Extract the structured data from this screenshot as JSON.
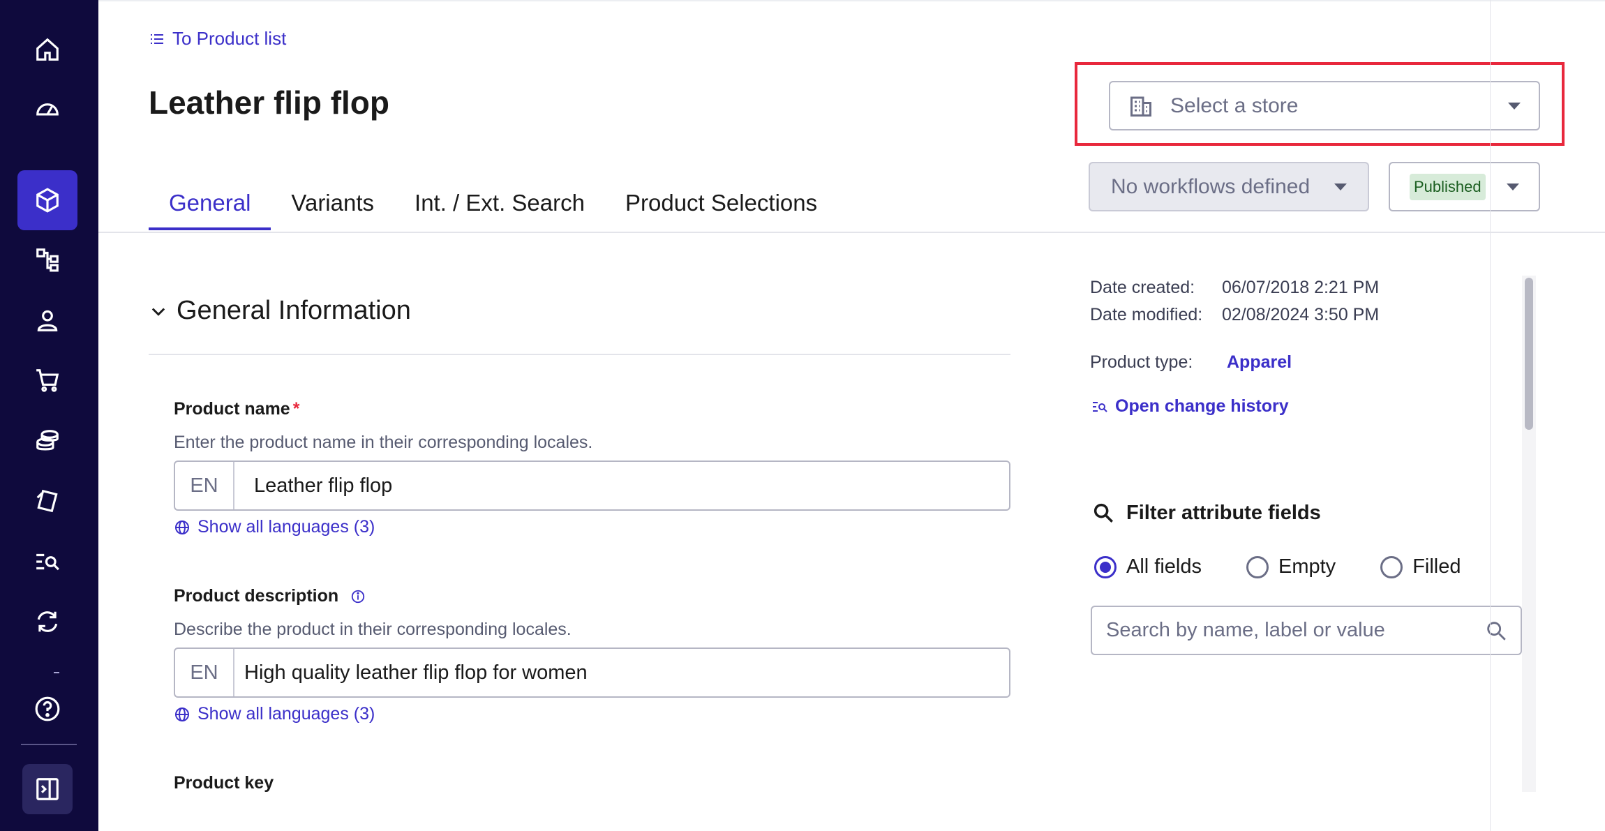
{
  "nav": {
    "items": [
      {
        "name": "home-icon"
      },
      {
        "name": "dashboard-icon"
      },
      {
        "name": "products-icon",
        "active": true
      },
      {
        "name": "categories-icon"
      },
      {
        "name": "customers-icon"
      },
      {
        "name": "orders-icon"
      },
      {
        "name": "prices-icon"
      },
      {
        "name": "discounts-icon"
      },
      {
        "name": "search-index-icon"
      },
      {
        "name": "operations-icon"
      },
      {
        "name": "help-icon"
      },
      {
        "name": "collapse-sidebar-icon"
      }
    ]
  },
  "header": {
    "back_link": "To Product list",
    "title": "Leather flip flop",
    "store_select_placeholder": "Select a store",
    "workflow_label": "No workflows defined",
    "status_label": "Published"
  },
  "tabs": [
    {
      "label": "General",
      "active": true
    },
    {
      "label": "Variants"
    },
    {
      "label": "Int. / Ext. Search"
    },
    {
      "label": "Product Selections"
    }
  ],
  "general": {
    "section_title": "General Information",
    "product_name": {
      "label": "Product name",
      "required_mark": "*",
      "hint": "Enter the product name in their corresponding locales.",
      "locale": "EN",
      "value": "Leather flip flop",
      "languages_link": "Show all languages (3)"
    },
    "product_description": {
      "label": "Product description",
      "hint": "Describe the product in their corresponding locales.",
      "locale": "EN",
      "value": "High quality leather flip flop for women",
      "languages_link": "Show all languages (3)"
    },
    "product_key": {
      "label": "Product key"
    }
  },
  "meta": {
    "date_created_label": "Date created:",
    "date_created_value": "06/07/2018 2:21 PM",
    "date_modified_label": "Date modified:",
    "date_modified_value": "02/08/2024 3:50 PM",
    "product_type_label": "Product type:",
    "product_type_value": "Apparel",
    "history_link": "Open change history"
  },
  "filter": {
    "title": "Filter attribute fields",
    "options": [
      {
        "label": "All fields",
        "checked": true
      },
      {
        "label": "Empty"
      },
      {
        "label": "Filled"
      }
    ],
    "search_placeholder": "Search by name, label or value"
  },
  "colors": {
    "sidebar_bg": "#0f0a3d",
    "accent": "#3b2fc9",
    "highlight": "#e8283c",
    "published_badge_bg": "#d7ebd9"
  }
}
